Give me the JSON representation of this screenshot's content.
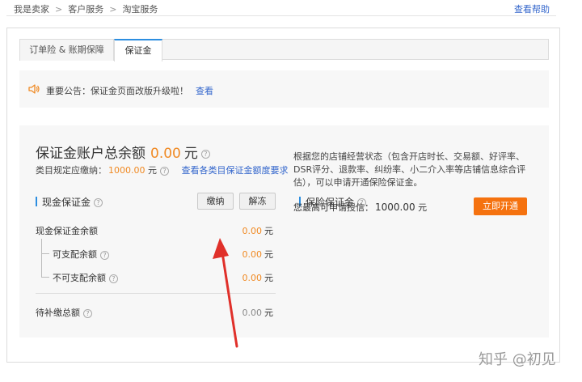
{
  "breadcrumb": {
    "items": [
      "我是卖家",
      "客户服务",
      "淘宝服务"
    ],
    "separator": ">"
  },
  "help_link": "查看帮助",
  "tabs": [
    {
      "label": "订单险 & 账期保障",
      "active": false
    },
    {
      "label": "保证金",
      "active": true
    }
  ],
  "notice": {
    "text": "重要公告：保证金页面改版升级啦！",
    "link": "查看"
  },
  "summary": {
    "total_label": "保证金账户总余额",
    "total_amount": "0.00",
    "total_unit": "元",
    "required_label": "类目规定应缴纳：",
    "required_amount": "1000.00",
    "required_unit": "元",
    "required_link": "查看各类目保证金额度要求"
  },
  "cash": {
    "title": "现金保证金",
    "pay_button": "缴纳",
    "unfreeze_button": "解冻",
    "rows": [
      {
        "label": "现金保证金余额",
        "value": "0.00",
        "unit": "元"
      },
      {
        "label": "可支配余额",
        "value": "0.00",
        "unit": "元"
      },
      {
        "label": "不可支配余额",
        "value": "0.00",
        "unit": "元"
      },
      {
        "label": "待补缴总额",
        "value": "0.00",
        "unit": "元"
      }
    ]
  },
  "insurance": {
    "title": "保险保证金",
    "description": "根据您的店铺经营状态（包含开店时长、交易额、好评率、DSR评分、退款率、纠纷率、小二介入率等店铺信息综合评估），可以申请开通保险保证金。",
    "max_label": "您最高可申请授信：",
    "max_amount": "1000.00",
    "max_unit": "元",
    "open_button": "立即开通"
  },
  "watermark": "知乎 @初见",
  "colors": {
    "accent_orange": "#f08a24",
    "link_blue": "#3366cc",
    "tab_active_blue": "#2d8ee0",
    "open_button": "#f5720f",
    "arrow_red": "#e0302a"
  },
  "icons": {
    "notice": "speaker-icon",
    "help": "question-circle-icon"
  }
}
